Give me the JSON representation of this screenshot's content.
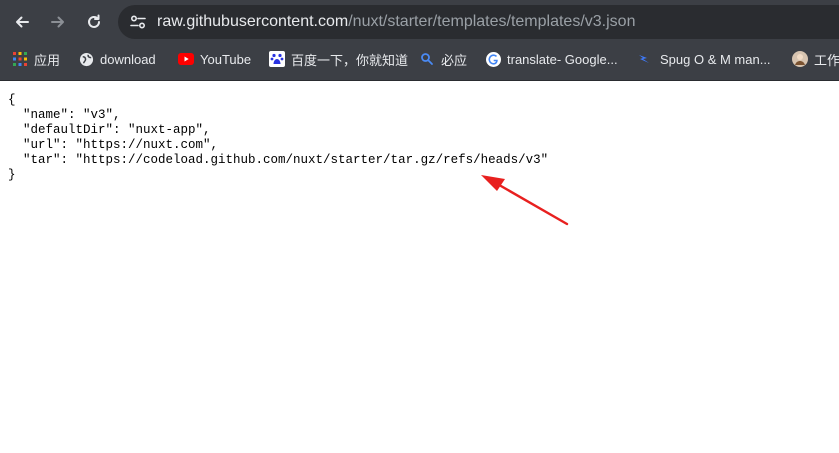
{
  "browser": {
    "url_host": "raw.githubusercontent.com",
    "url_path": "/nuxt/starter/templates/templates/v3.json"
  },
  "bookmarks": [
    {
      "label": "应用",
      "icon": "apps-grid-icon"
    },
    {
      "label": "download",
      "icon": "globe-icon"
    },
    {
      "label": "YouTube",
      "icon": "youtube-icon"
    },
    {
      "label": "百度一下，你就知道",
      "icon": "baidu-paw-icon"
    },
    {
      "label": "必应",
      "icon": "bing-search-icon"
    },
    {
      "label": "translate- Google...",
      "icon": "google-g-icon"
    },
    {
      "label": "Spug O & M man...",
      "icon": "spug-icon"
    },
    {
      "label": "工作",
      "icon": "avatar-icon"
    }
  ],
  "json_lines": [
    "{",
    "  \"name\": \"v3\",",
    "  \"defaultDir\": \"nuxt-app\",",
    "  \"url\": \"https://nuxt.com\",",
    "  \"tar\": \"https://codeload.github.com/nuxt/starter/tar.gz/refs/heads/v3\"",
    "}"
  ],
  "annotation": {
    "color": "#e8201f",
    "icon": "red-arrow-annotation"
  }
}
